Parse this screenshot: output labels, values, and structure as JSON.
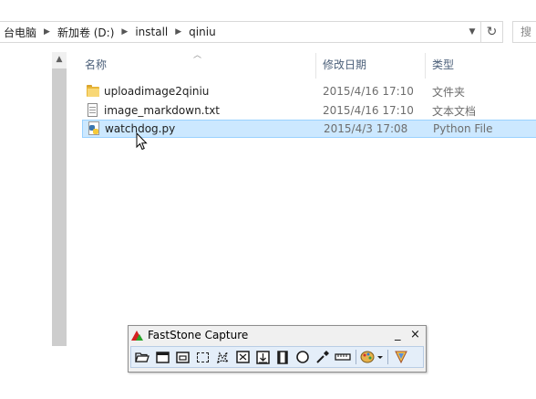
{
  "address_bar": {
    "crumbs": [
      "台电脑",
      "新加卷 (D:)",
      "install",
      "qiniu"
    ],
    "search_placeholder": "搜"
  },
  "columns": {
    "name": "名称",
    "date_modified": "修改日期",
    "type": "类型"
  },
  "files": [
    {
      "name": "uploadimage2qiniu",
      "date": "2015/4/16 17:10",
      "type": "文件夹",
      "icon": "folder-icon",
      "selected": false
    },
    {
      "name": "image_markdown.txt",
      "date": "2015/4/16 17:10",
      "type": "文本文档",
      "icon": "text-file-icon",
      "selected": false
    },
    {
      "name": "watchdog.py",
      "date": "2015/4/3 17:08",
      "type": "Python File",
      "icon": "python-file-icon",
      "selected": true
    }
  ],
  "faststone": {
    "title": "FastStone Capture",
    "minimize": "_",
    "close": "×",
    "tools": [
      "open-icon",
      "capture-active-window-icon",
      "capture-window-object-icon",
      "capture-rectangle-icon",
      "capture-freehand-icon",
      "capture-full-screen-icon",
      "capture-scrolling-window-icon",
      "screen-recorder-icon",
      "magnifier-icon",
      "color-picker-icon",
      "screen-ruler-icon",
      "output-options-icon",
      "settings-icon"
    ]
  },
  "colors": {
    "selection_bg": "#cce8ff",
    "selection_border": "#99d1ff",
    "header_text": "#4c607a",
    "toolbar_bg": "#e4eef9"
  }
}
